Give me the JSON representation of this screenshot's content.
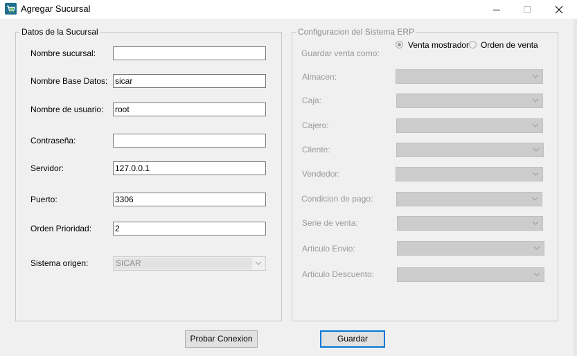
{
  "window": {
    "title": "Agregar Sucursal",
    "icon": "store-cart-icon"
  },
  "left_group": {
    "legend": "Datos de la Sucursal",
    "fields": [
      {
        "label": "Nombre sucursal:",
        "value": ""
      },
      {
        "label": "Nombre Base Datos:",
        "value": "sicar"
      },
      {
        "label": "Nombre de usuario:",
        "value": "root"
      },
      {
        "label": "Contraseña:",
        "value": ""
      },
      {
        "label": "Servidor:",
        "value": "127.0.0.1"
      },
      {
        "label": "Puerto:",
        "value": "3306"
      },
      {
        "label": "Orden Prioridad:",
        "value": "2"
      }
    ],
    "origin_label": "Sistema origen:",
    "origin_value": "SICAR"
  },
  "right_group": {
    "legend": "Configuracion del Sistema ERP",
    "save_as_label": "Guardar venta como:",
    "radio_options": [
      {
        "label": "Venta mostrador",
        "checked": true
      },
      {
        "label": "Orden de venta",
        "checked": false
      }
    ],
    "combo_labels": [
      "Almacen:",
      "Caja:",
      "Cajero:",
      "Cliente:",
      "Vendedor:",
      "Condicion de pago:",
      "Serie de venta:",
      "Articulo Envio:",
      "Articulo Descuento:"
    ]
  },
  "buttons": {
    "test_connection": "Probar Conexion",
    "save": "Guardar"
  },
  "colors": {
    "accent": "#0078d7",
    "disabled_combo": "#cccccc",
    "disabled_text": "#9a9a9a",
    "background": "#f0f0f0"
  }
}
